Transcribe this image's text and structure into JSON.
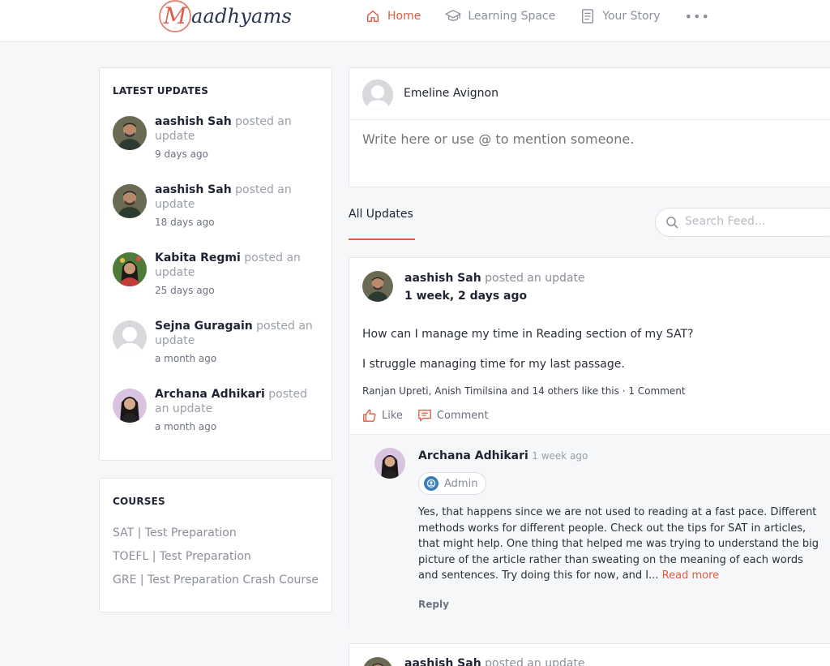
{
  "brand": {
    "logo_letter": "M",
    "logo_text": "aadhyams"
  },
  "nav": {
    "items": [
      {
        "label": "Home",
        "icon": "home-icon",
        "active": true
      },
      {
        "label": "Learning Space",
        "icon": "graduation-cap-icon",
        "active": false
      },
      {
        "label": "Your Story",
        "icon": "document-icon",
        "active": false
      }
    ],
    "more": "•••"
  },
  "colors": {
    "accent": "#e05a44",
    "brand_navy": "#2b3354",
    "admin_blue": "#3c7fbf"
  },
  "latest_updates": {
    "title": "LATEST UPDATES",
    "items": [
      {
        "name": "aashish Sah",
        "action": "posted an update",
        "time": "9 days ago"
      },
      {
        "name": "aashish Sah",
        "action": "posted an update",
        "time": "18 days ago"
      },
      {
        "name": "Kabita Regmi",
        "action": "posted an update",
        "time": "25 days ago"
      },
      {
        "name": "Sejna Guragain",
        "action": "posted an update",
        "time": "a month ago"
      },
      {
        "name": "Archana Adhikari",
        "action": "posted an update",
        "time": "a month ago"
      }
    ]
  },
  "courses": {
    "title": "COURSES",
    "items": [
      "SAT | Test Preparation",
      "TOEFL | Test Preparation",
      "GRE | Test Preparation Crash Course"
    ]
  },
  "composer": {
    "user_name": "Emeline Avignon",
    "placeholder": "Write here or use @ to mention someone."
  },
  "feed": {
    "tab_label": "All Updates",
    "search_placeholder": "Search Feed..."
  },
  "post": {
    "author": "aashish Sah",
    "action": "posted an update",
    "time": "1 week, 2 days ago",
    "body_line1": "How can I manage my time in Reading section of my SAT?",
    "body_line2": "I struggle managing time for my last passage.",
    "stats": "Ranjan Upreti, Anish Timilsina and 14 others like this · 1 Comment",
    "like_label": "Like",
    "comment_label": "Comment",
    "comment": {
      "author": "Archana Adhikari",
      "time": "1 week ago",
      "badge": "Admin",
      "text": "Yes, that happens since we are not used to reading at a fast pace. Different methods works for different people. Check out the tips for SAT in articles, that might help. One thing that helped me was trying to understand the big picture of the article rather than sweating on the meaning of each words and sentences. Try doing this for now, and I...",
      "read_more": "Read more",
      "reply": "Reply"
    }
  },
  "next_post": {
    "author": "aashish Sah",
    "action": "posted an update"
  }
}
